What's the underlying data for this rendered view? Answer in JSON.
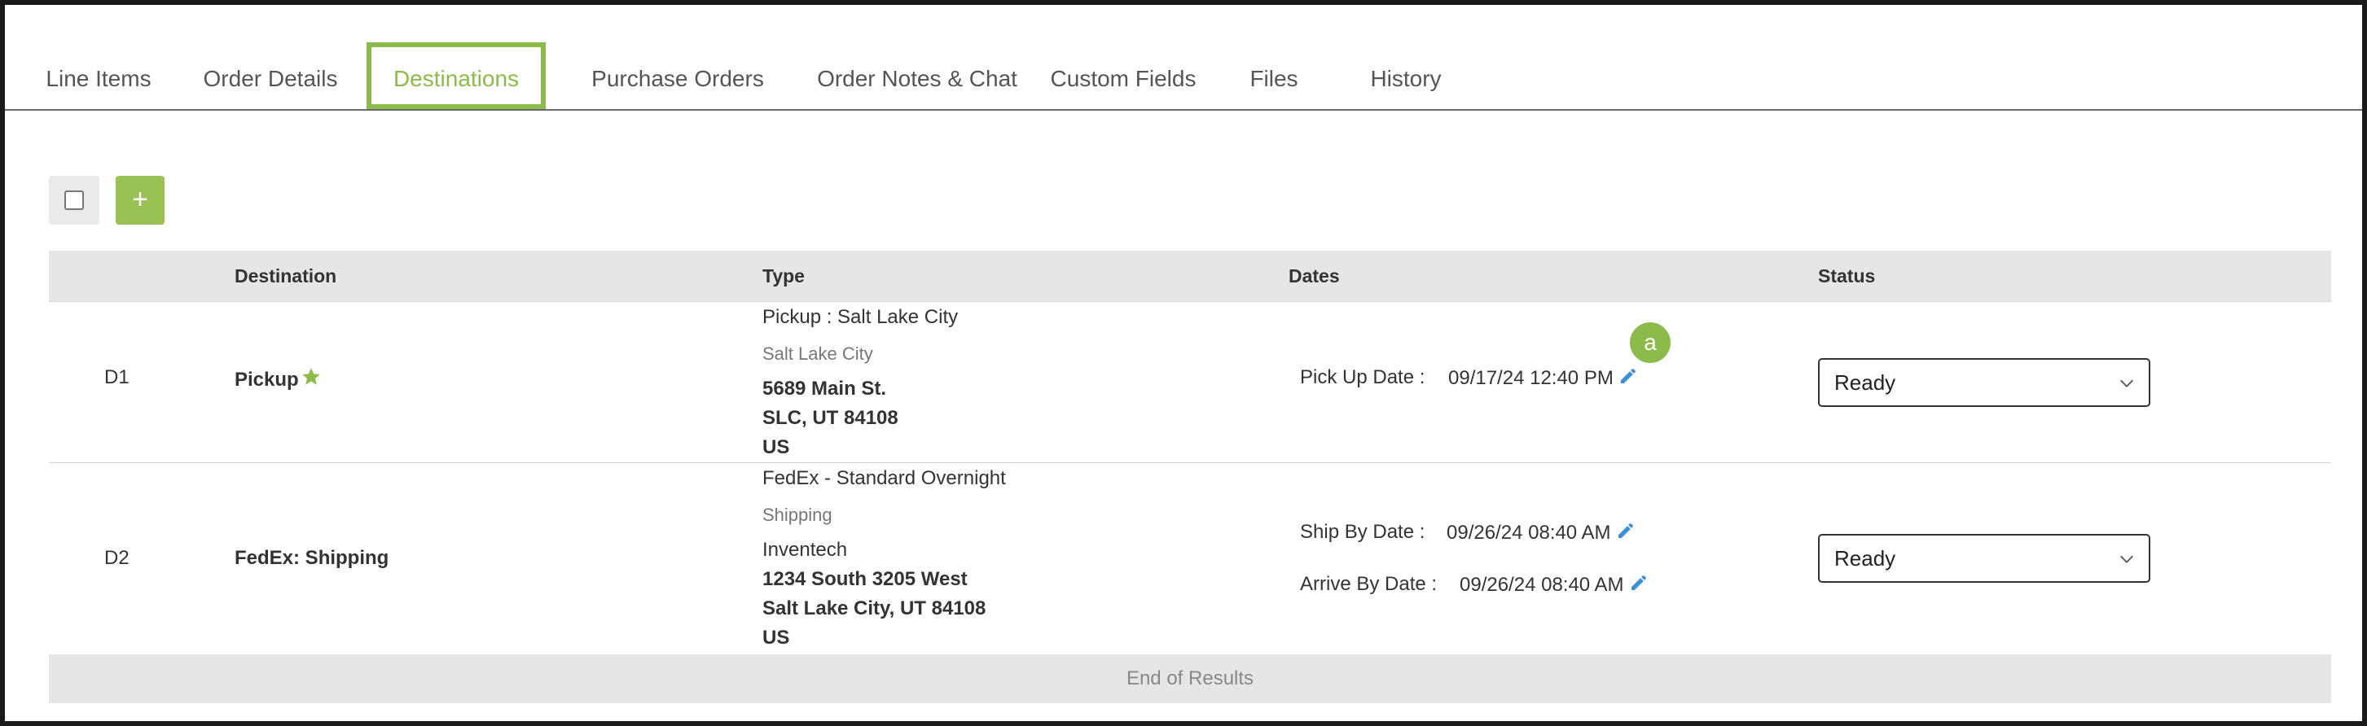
{
  "tabs": [
    {
      "label": "Line Items"
    },
    {
      "label": "Order Details"
    },
    {
      "label": "Destinations",
      "active": true
    },
    {
      "label": "Purchase Orders"
    },
    {
      "label": "Order Notes & Chat"
    },
    {
      "label": "Custom Fields"
    },
    {
      "label": "Files"
    },
    {
      "label": "History"
    }
  ],
  "toolbar": {
    "add_label": "+"
  },
  "table": {
    "headers": {
      "destination": "Destination",
      "type": "Type",
      "dates": "Dates",
      "status": "Status"
    },
    "rows": [
      {
        "id": "D1",
        "destination": "Pickup",
        "type_title": "Pickup : Salt Lake City",
        "type_sub": "Salt Lake City",
        "address": [
          "5689 Main St.",
          "SLC, UT 84108",
          "US"
        ],
        "dates": [
          {
            "label": "Pick Up Date :",
            "value": "09/17/24 12:40 PM"
          }
        ],
        "status": "Ready"
      },
      {
        "id": "D2",
        "destination": "FedEx: Shipping",
        "type_title": "FedEx - Standard Overnight",
        "type_sub": "Shipping",
        "address": [
          "Inventech",
          "1234 South 3205 West",
          "Salt Lake City, UT 84108",
          "US"
        ],
        "dates": [
          {
            "label": "Ship By Date :",
            "value": "09/26/24 08:40 AM"
          },
          {
            "label": "Arrive By Date :",
            "value": "09/26/24 08:40 AM"
          }
        ],
        "status": "Ready"
      }
    ],
    "footer": "End of Results"
  },
  "annotation": {
    "badge": "a"
  },
  "colors": {
    "accent": "#8dbb4a",
    "add_button": "#98c254",
    "pencil": "#3a8fd6",
    "header_bg": "#e6e6e6"
  }
}
